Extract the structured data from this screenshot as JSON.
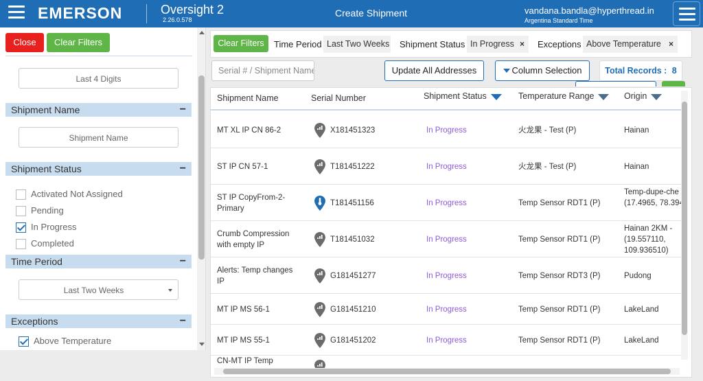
{
  "header": {
    "brand": "EMERSON",
    "app_name": "Oversight 2",
    "version": "2.26.0.578",
    "title": "Create Shipment",
    "user": "vandana.bandla@hyperthread.in",
    "timezone": "Argentina Standard Time",
    "color": "#1f6db5"
  },
  "sidebar": {
    "close_label": "Close",
    "clear_filters_label": "Clear Filters",
    "last4_placeholder": "Last 4 Digits",
    "sections": {
      "shipment_name": {
        "title": "Shipment Name",
        "placeholder": "Shipment Name"
      },
      "shipment_status": {
        "title": "Shipment Status",
        "options": [
          {
            "label": "Activated Not Assigned",
            "checked": false
          },
          {
            "label": "Pending",
            "checked": false
          },
          {
            "label": "In Progress",
            "checked": true
          },
          {
            "label": "Completed",
            "checked": false
          }
        ]
      },
      "time_period": {
        "title": "Time Period",
        "selected": "Last Two Weeks"
      },
      "exceptions": {
        "title": "Exceptions",
        "options": [
          {
            "label": "Above Temperature",
            "checked": true
          }
        ]
      }
    },
    "collapse_symbol": "−"
  },
  "filter_bar": {
    "clear_label": "Clear Filters",
    "time_period_label": "Time Period",
    "time_period_value": "Last Two Weeks",
    "status_label": "Shipment Status",
    "status_value": "In Progress",
    "exceptions_label": "Exceptions",
    "exceptions_value": "Above Temperature",
    "remove_symbol": "×"
  },
  "toolbar": {
    "search_placeholder": "Serial # / Shipment Name",
    "update_addresses_label": "Update All Addresses",
    "column_selection_label": "Column Selection",
    "total_records_label": "Total Records :",
    "total_records_value": "8"
  },
  "grid": {
    "columns": [
      "Shipment Name",
      "Serial Number",
      "Shipment Status",
      "Temperature Range",
      "Origin"
    ],
    "rows": [
      {
        "name": "MT XL IP CN 86-2",
        "serial": "X181451323",
        "status": "In Progress",
        "temp": "火龙果 - Test (P)",
        "origin": "Hainan",
        "icon": "gray"
      },
      {
        "name": "ST IP CN 57-1",
        "serial": "T181451222",
        "status": "In Progress",
        "temp": "火龙果 - Test (P)",
        "origin": "Hainan",
        "icon": "gray"
      },
      {
        "name": "ST IP CopyFrom-2-Primary",
        "serial": "T181451156",
        "status": "In Progress",
        "temp": "Temp Sensor RDT1 (P)",
        "origin": "Temp-dupe-che (17.4965, 78.394",
        "icon": "blue"
      },
      {
        "name": "Crumb Compression with empty IP",
        "serial": "T181451032",
        "status": "In Progress",
        "temp": "Temp Sensor RDT1 (P)",
        "origin": "Hainan 2KM - (19.557110, 109.936510)",
        "icon": "gray"
      },
      {
        "name": "Alerts: Temp changes IP",
        "serial": "G181451277",
        "status": "In Progress",
        "temp": "Temp Sensor RDT3 (P)",
        "origin": "Pudong",
        "icon": "gray"
      },
      {
        "name": "MT IP MS 56-1",
        "serial": "G181451210",
        "status": "In Progress",
        "temp": "Temp Sensor RDT1 (P)",
        "origin": "LakeLand",
        "icon": "gray"
      },
      {
        "name": "MT IP MS 55-1",
        "serial": "G181451202",
        "status": "In Progress",
        "temp": "Temp Sensor RDT1 (P)",
        "origin": "LakeLand",
        "icon": "gray"
      },
      {
        "name": "CN-MT IP Temp",
        "serial": "",
        "status": "",
        "temp": "",
        "origin": "",
        "icon": "gray"
      }
    ]
  }
}
